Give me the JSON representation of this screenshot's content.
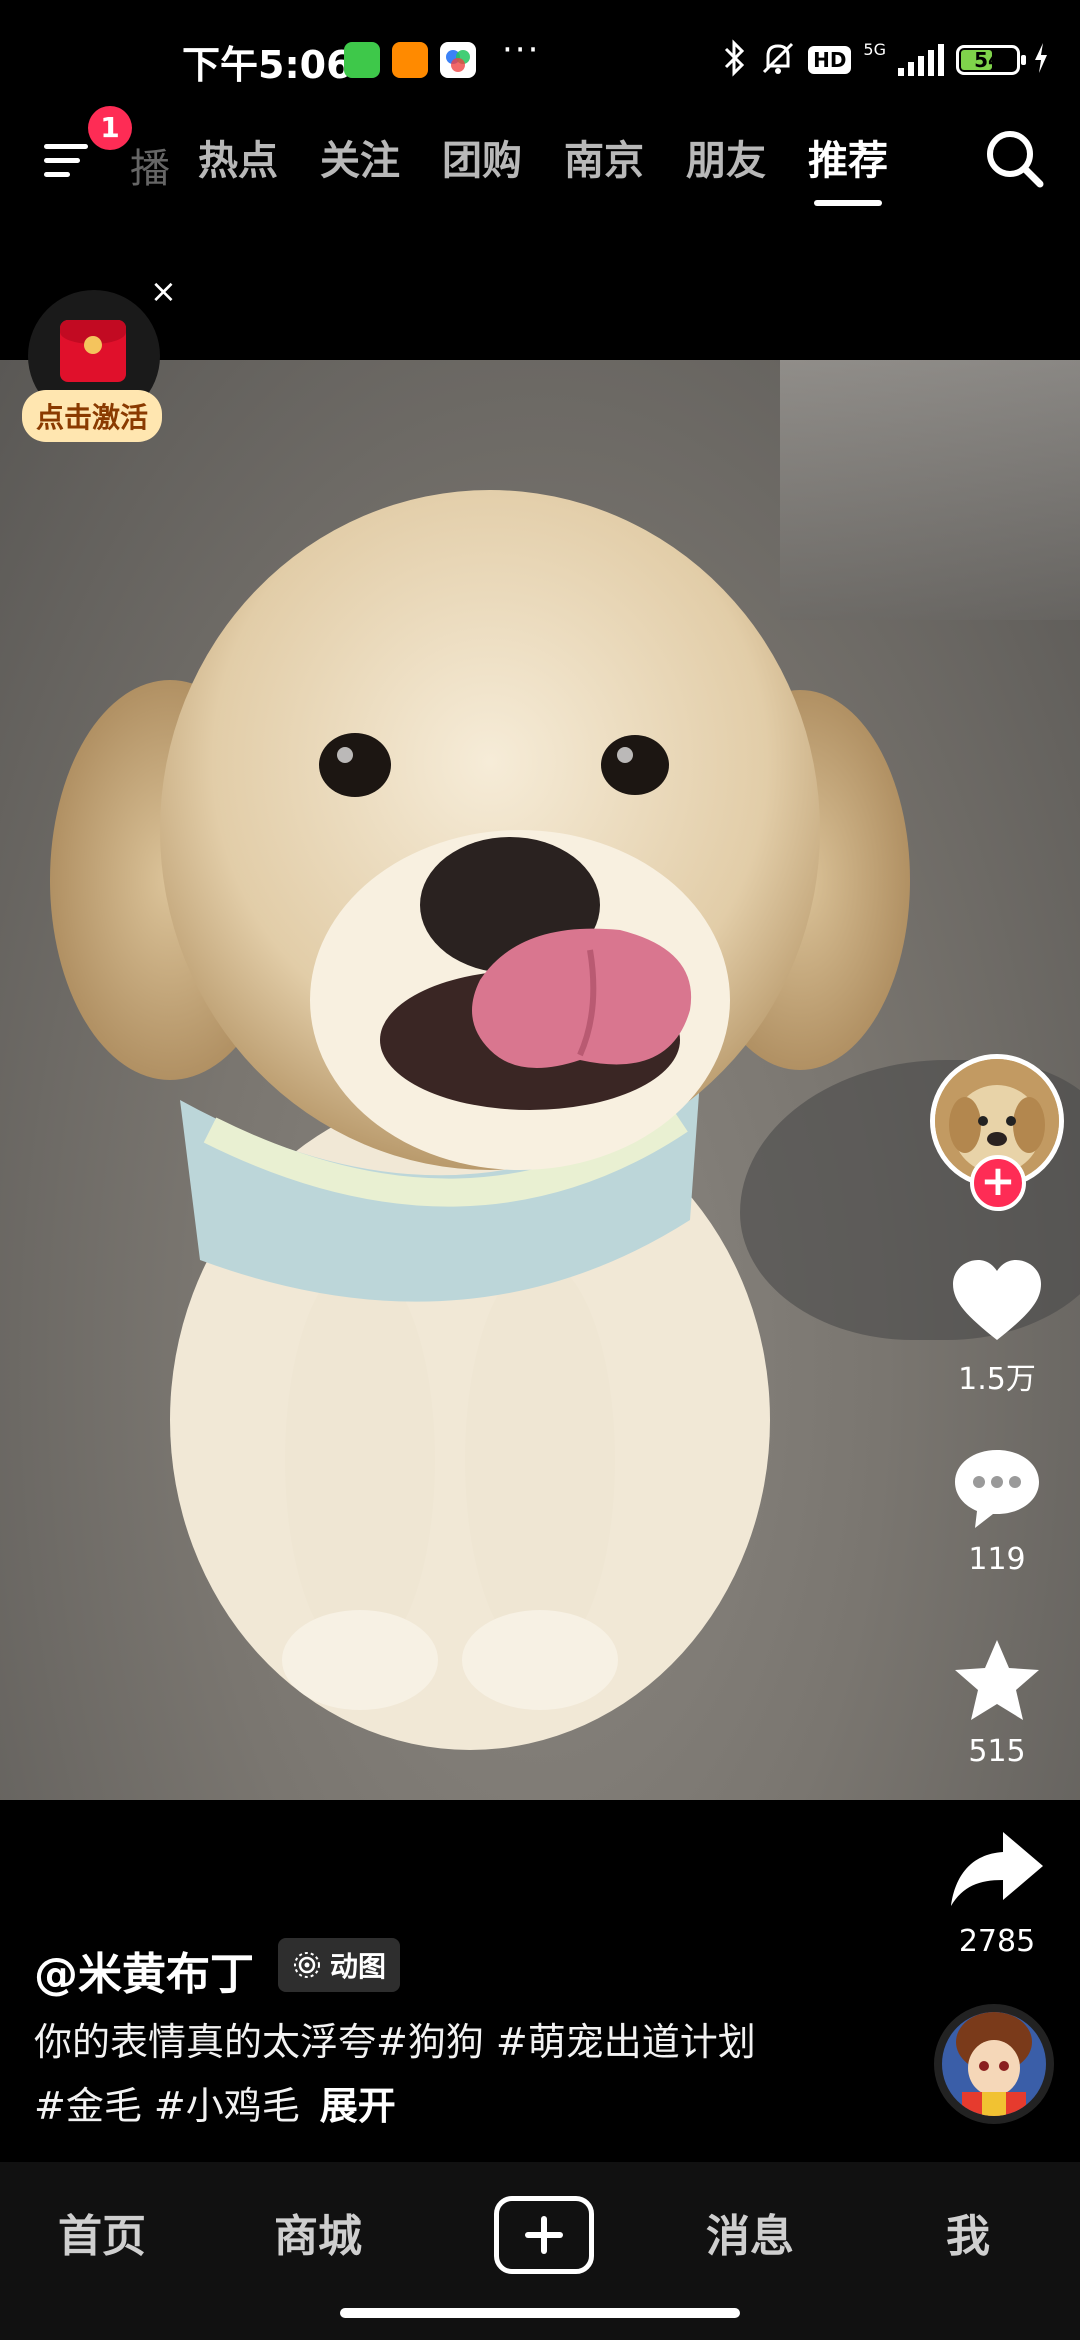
{
  "status_bar": {
    "time": "下午5:06",
    "app_icons": [
      "wechat-icon",
      "58-app-icon",
      "baidu-netdisk-icon"
    ],
    "more": "···",
    "hd_badge": "HD",
    "network": "5G",
    "battery_level": "54"
  },
  "top_nav": {
    "menu_badge": "1",
    "faded_tab": "播",
    "tabs": [
      {
        "label": "热点"
      },
      {
        "label": "关注"
      },
      {
        "label": "团购"
      },
      {
        "label": "南京"
      },
      {
        "label": "朋友"
      },
      {
        "label": "推荐",
        "active": true
      }
    ]
  },
  "red_packet": {
    "label": "点击激活",
    "close": "×"
  },
  "right_rail": {
    "like_count": "1.5万",
    "comment_count": "119",
    "favorite_count": "515",
    "share_count": "2785"
  },
  "caption": {
    "author": "@米黄布丁",
    "motion_tag": "动图",
    "text_line1": "你的表情真的太浮夸#狗狗 #萌宠出道计划",
    "text_line2": "#金毛 #小鸡毛",
    "expand": "展开"
  },
  "bottom_nav": {
    "home": "首页",
    "mall": "商城",
    "messages": "消息",
    "me": "我"
  },
  "colors": {
    "accent": "#fe2c55",
    "battery": "#7fd34b",
    "background": "#000000"
  }
}
